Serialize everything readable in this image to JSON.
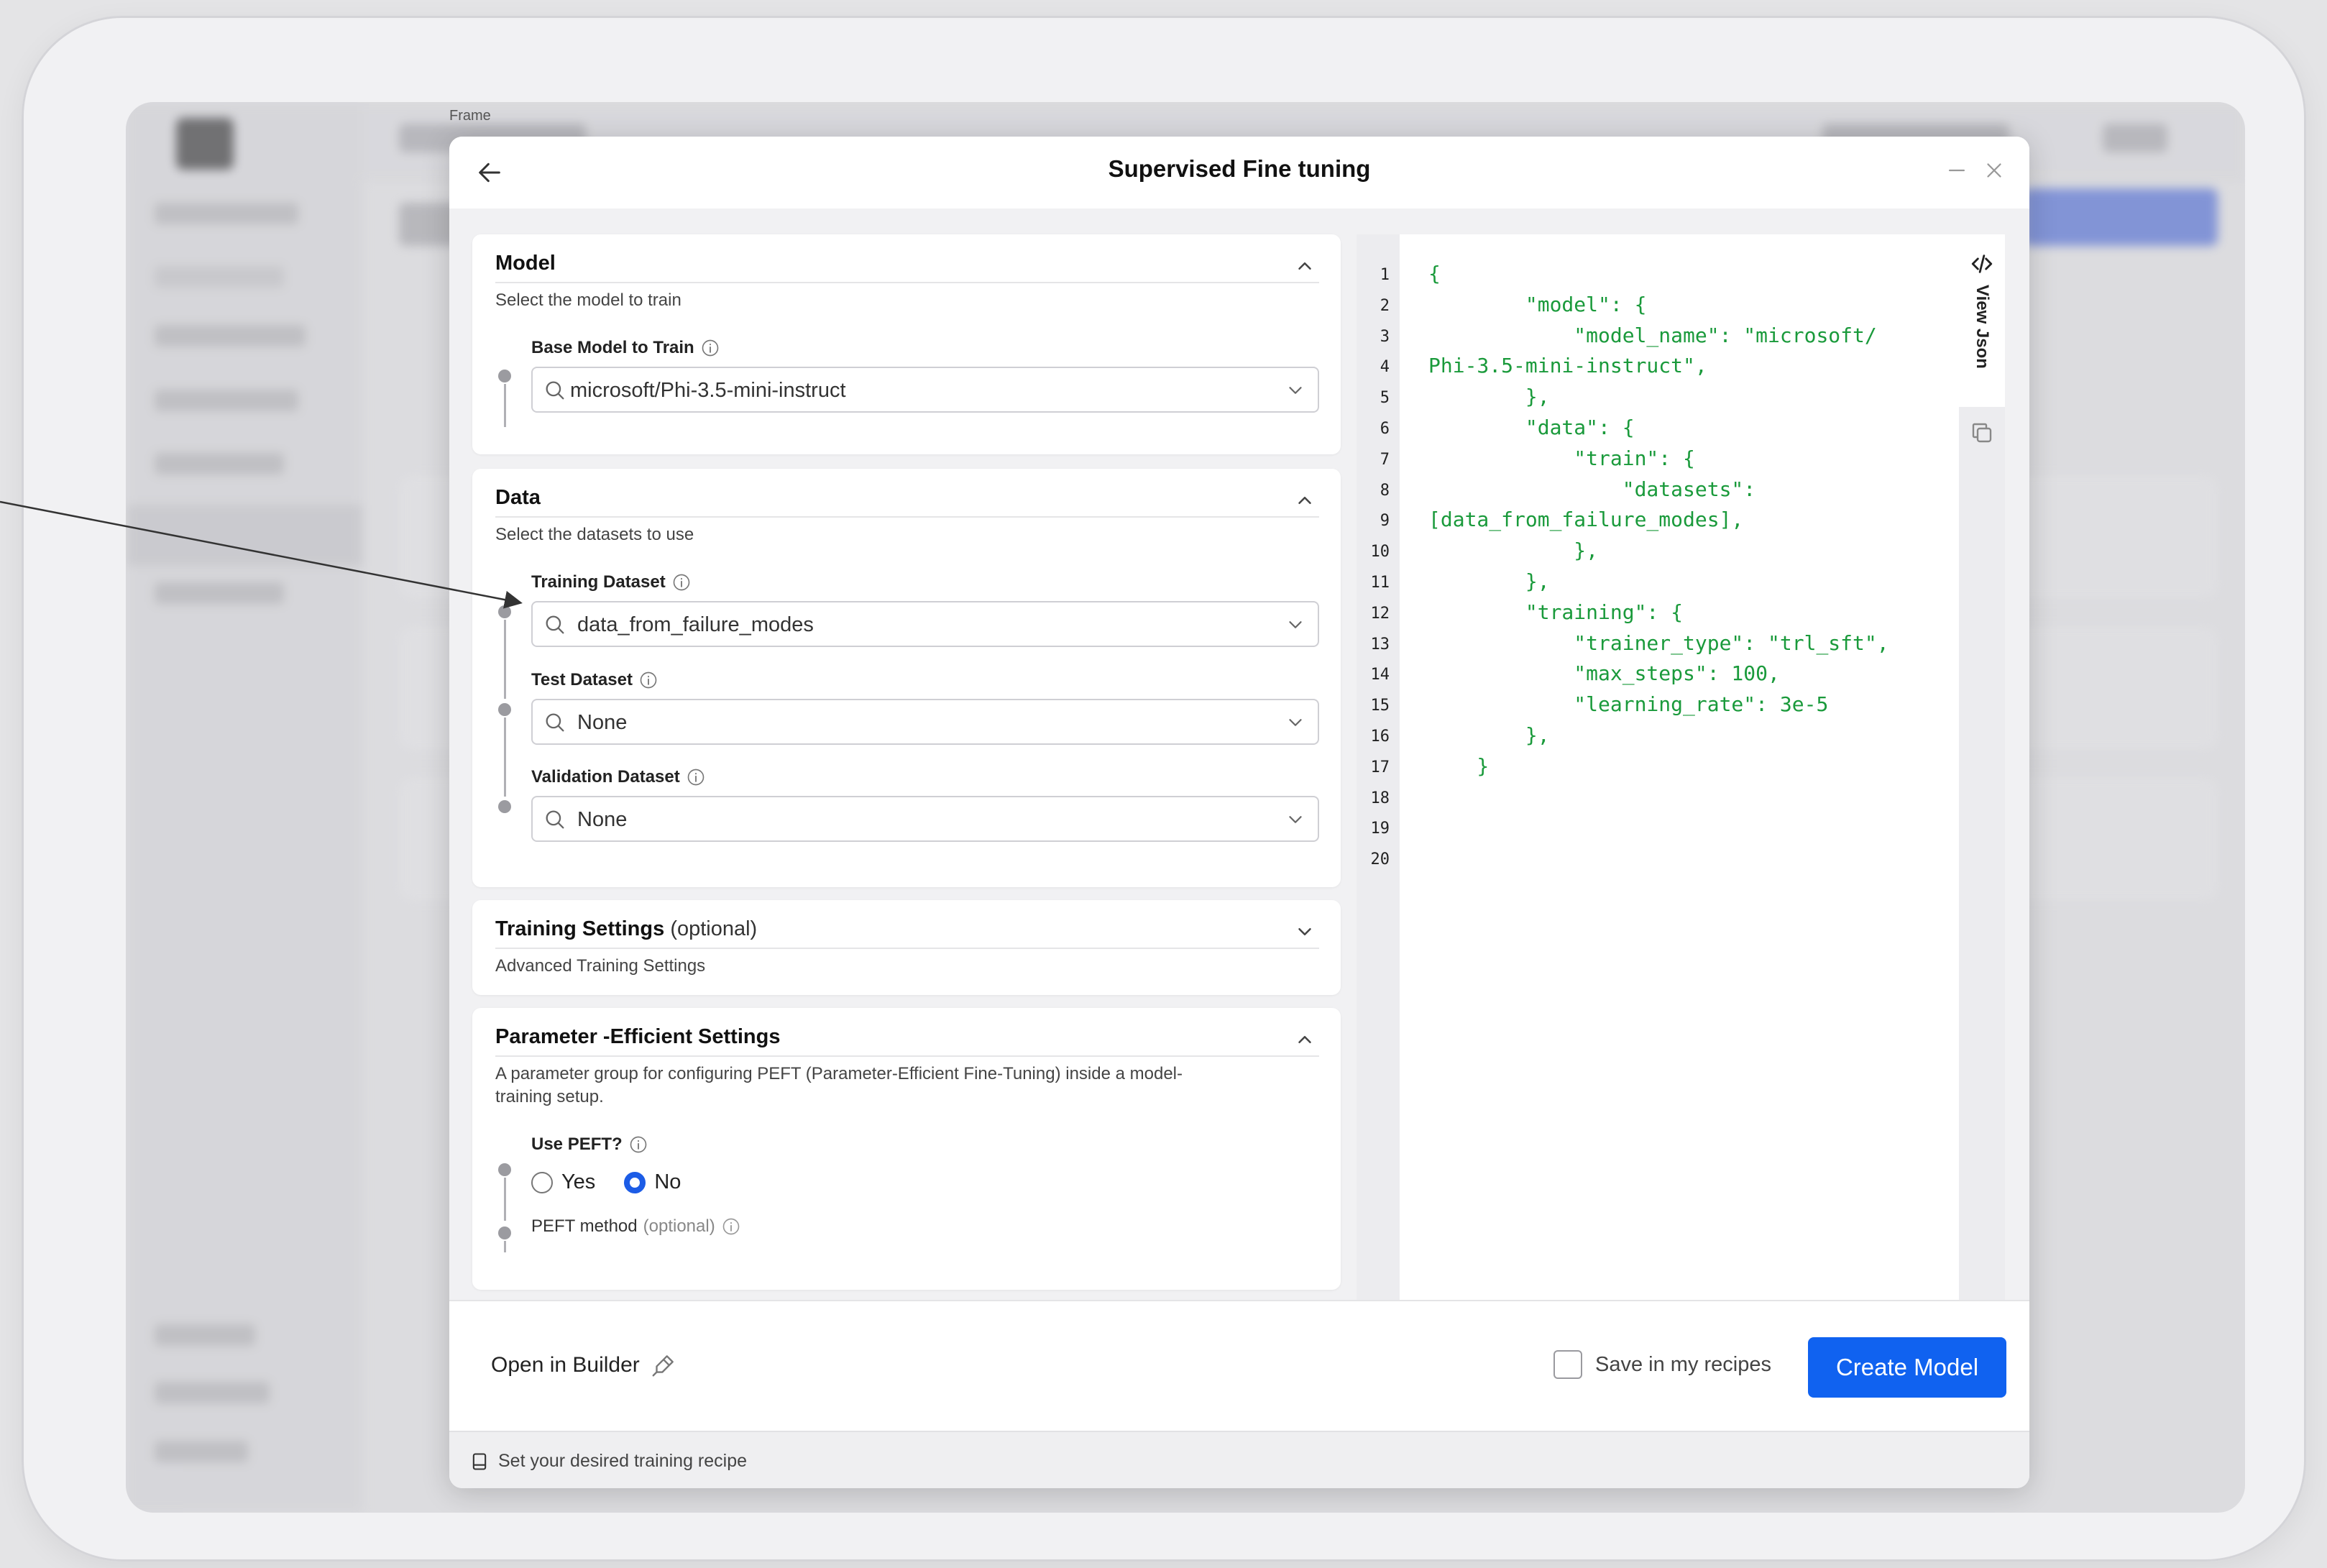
{
  "frame_label": "Frame",
  "dialog": {
    "title": "Supervised Fine tuning",
    "model_card": {
      "title": "Model",
      "subtitle": "Select the model to train",
      "base_model_label": "Base Model to Train",
      "base_model_value": "microsoft/Phi-3.5-mini-instruct"
    },
    "data_card": {
      "title": "Data",
      "subtitle": "Select the datasets to use",
      "training_label": "Training Dataset",
      "training_value": "data_from_failure_modes",
      "test_label": "Test Dataset",
      "test_value": "None",
      "validation_label": "Validation Dataset",
      "validation_value": "None"
    },
    "training_card": {
      "title": "Training Settings",
      "title_optional": "(optional)",
      "subtitle": "Advanced Training Settings"
    },
    "peft_card": {
      "title": "Parameter -Efficient  Settings",
      "subtitle_line1": "A parameter group for configuring PEFT (Parameter-Efficient Fine-Tuning) inside a model-",
      "subtitle_line2": "training setup.",
      "use_peft_label": "Use PEFT?",
      "option_yes": "Yes",
      "option_no": "No",
      "selected_option": "No",
      "peft_method_label": "PEFT method",
      "peft_method_optional": "(optional)"
    },
    "json_panel": {
      "tab_label": "View Json",
      "line_numbers": [
        "1",
        "2",
        "3",
        "4",
        "5",
        "6",
        "7",
        "8",
        "9",
        "10",
        "11",
        "12",
        "13",
        "14",
        "15",
        "16",
        "17",
        "18",
        "19",
        "20"
      ],
      "lines": [
        "{",
        "        \"model\": {",
        "            \"model_name\": \"microsoft/",
        "Phi-3.5-mini-instruct\",",
        "        },",
        "        \"data\": {",
        "            \"train\": {",
        "                \"datasets\":",
        "[data_from_failure_modes],",
        "            },",
        "        },",
        "        \"training\": {",
        "            \"trainer_type\": \"trl_sft\",",
        "            \"max_steps\": 100,",
        "            \"learning_rate\": 3e-5",
        "        },",
        "    }",
        "",
        "",
        ""
      ]
    },
    "footer": {
      "open_builder_label": "Open in Builder",
      "save_recipes_label": "Save in my recipes",
      "create_button_label": "Create Model"
    },
    "status_text": "Set your desired training recipe"
  },
  "colors": {
    "accent": "#1062f0",
    "json_text": "#1a9a3b"
  }
}
